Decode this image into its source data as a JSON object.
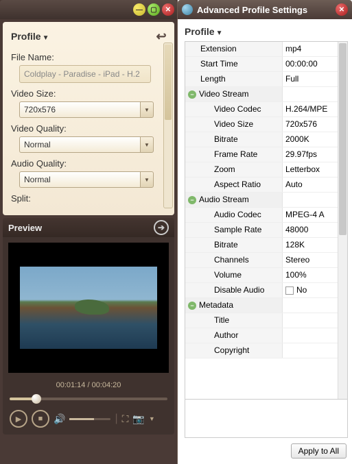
{
  "left": {
    "profile_header": "Profile",
    "file_name_label": "File Name:",
    "file_name_value": "Coldplay - Paradise - iPad - H.2",
    "video_size_label": "Video Size:",
    "video_size_value": "720x576",
    "video_quality_label": "Video Quality:",
    "video_quality_value": "Normal",
    "audio_quality_label": "Audio Quality:",
    "audio_quality_value": "Normal",
    "split_label": "Split:"
  },
  "preview": {
    "header": "Preview",
    "time_display": "00:01:14 / 00:04:20"
  },
  "right": {
    "title": "Advanced Profile Settings",
    "section_title": "Profile",
    "apply_label": "Apply to All",
    "rows": {
      "extension_k": "Extension",
      "extension_v": "mp4",
      "start_time_k": "Start Time",
      "start_time_v": "00:00:00",
      "length_k": "Length",
      "length_v": "Full",
      "video_stream": "Video Stream",
      "vcodec_k": "Video Codec",
      "vcodec_v": "H.264/MPE",
      "vsize_k": "Video Size",
      "vsize_v": "720x576",
      "vbitrate_k": "Bitrate",
      "vbitrate_v": "2000K",
      "vfps_k": "Frame Rate",
      "vfps_v": "29.97fps",
      "vzoom_k": "Zoom",
      "vzoom_v": "Letterbox",
      "vaspect_k": "Aspect Ratio",
      "vaspect_v": "Auto",
      "audio_stream": "Audio Stream",
      "acodec_k": "Audio Codec",
      "acodec_v": "MPEG-4 A",
      "asample_k": "Sample Rate",
      "asample_v": "48000",
      "abitrate_k": "Bitrate",
      "abitrate_v": "128K",
      "achan_k": "Channels",
      "achan_v": "Stereo",
      "avol_k": "Volume",
      "avol_v": "100%",
      "adisable_k": "Disable Audio",
      "adisable_v": "No",
      "metadata": "Metadata",
      "mtitle_k": "Title",
      "mtitle_v": "",
      "mauthor_k": "Author",
      "mauthor_v": "",
      "mcopy_k": "Copyright",
      "mcopy_v": ""
    }
  }
}
